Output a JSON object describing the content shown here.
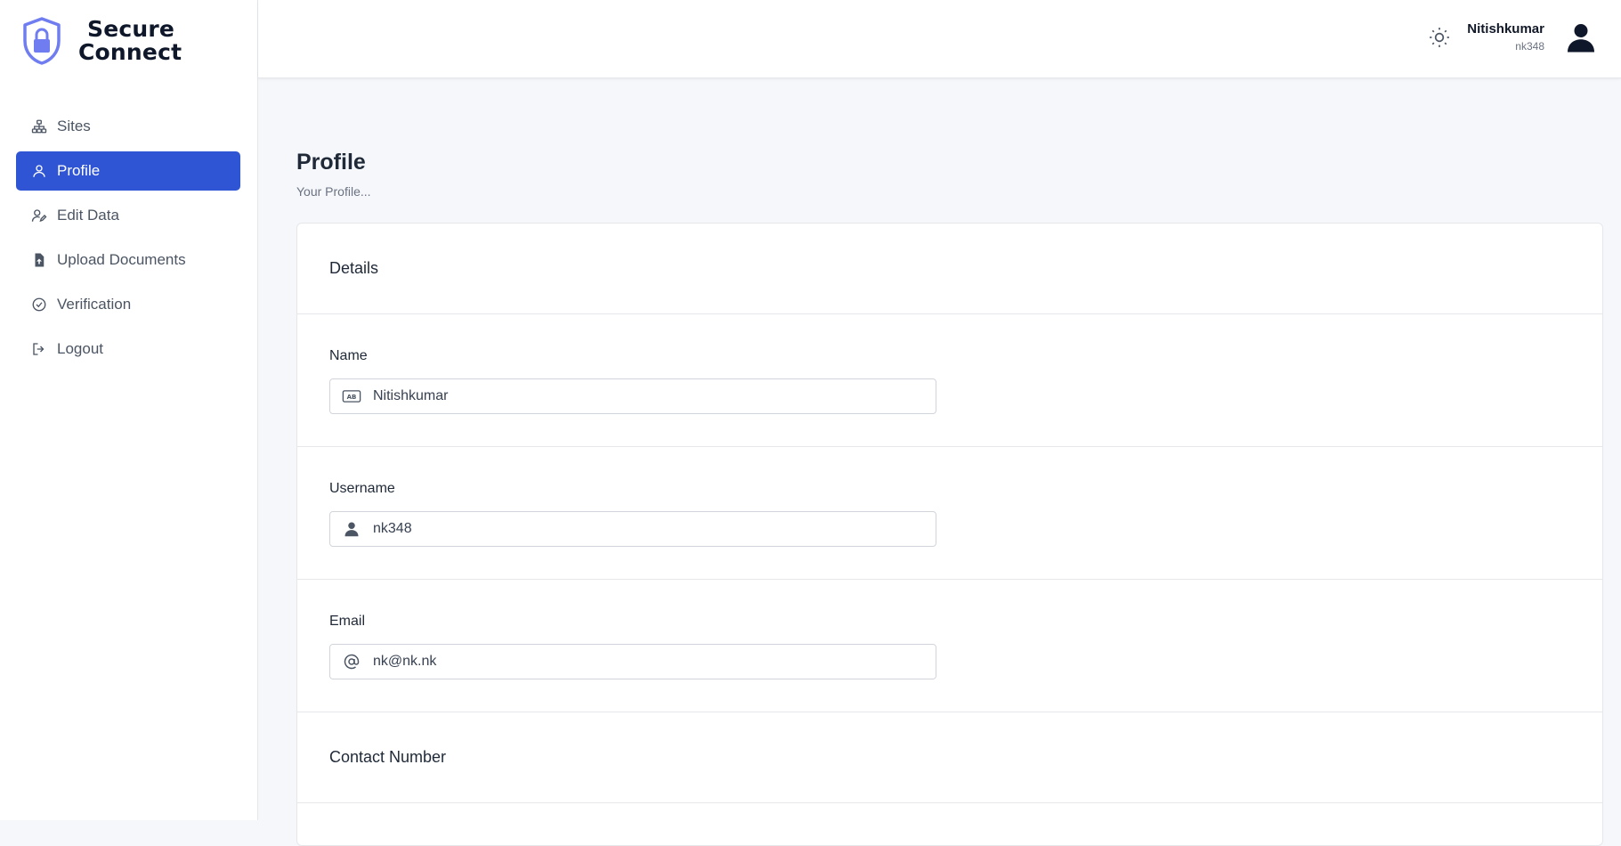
{
  "brand": {
    "line1": "Secure",
    "line2": "Connect",
    "accent": "#6f7df0"
  },
  "sidebar": {
    "items": [
      {
        "label": "Sites",
        "icon": "sitemap-icon",
        "active": false
      },
      {
        "label": "Profile",
        "icon": "user-icon",
        "active": true
      },
      {
        "label": "Edit Data",
        "icon": "user-edit-icon",
        "active": false
      },
      {
        "label": "Upload Documents",
        "icon": "file-upload-icon",
        "active": false
      },
      {
        "label": "Verification",
        "icon": "check-circle-icon",
        "active": false
      },
      {
        "label": "Logout",
        "icon": "logout-icon",
        "active": false
      }
    ],
    "active_color": "#2f55d4"
  },
  "header": {
    "theme_icon": "sun-icon",
    "user_name": "Nitishkumar",
    "user_handle": "nk348",
    "avatar_icon": "user-avatar-icon"
  },
  "main": {
    "title": "Profile",
    "subtitle": "Your Profile...",
    "card": {
      "details_title": "Details",
      "fields": [
        {
          "label": "Name",
          "value": "Nitishkumar",
          "icon": "id-card-icon"
        },
        {
          "label": "Username",
          "value": "nk348",
          "icon": "user-icon"
        },
        {
          "label": "Email",
          "value": "nk@nk.nk",
          "icon": "at-icon"
        }
      ],
      "contact_title": "Contact Number"
    }
  }
}
